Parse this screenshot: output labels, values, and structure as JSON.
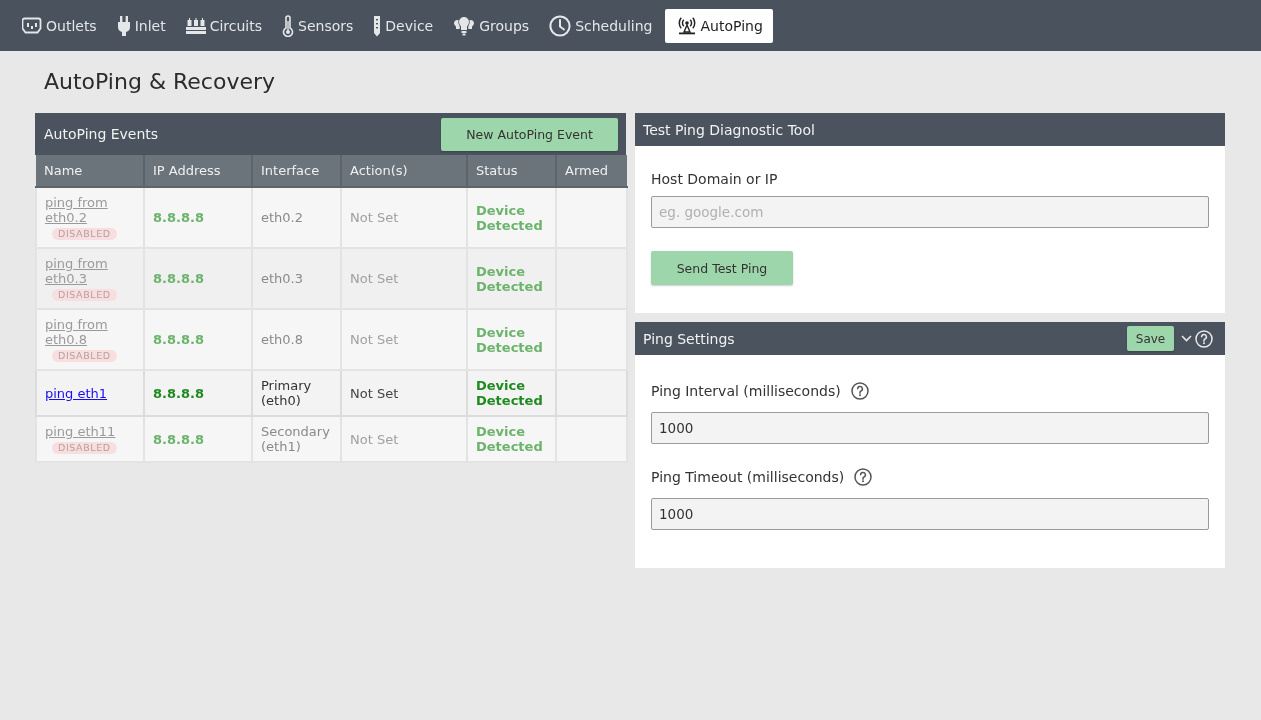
{
  "nav": {
    "tabs": [
      {
        "label": "Outlets",
        "selected": false
      },
      {
        "label": "Inlet",
        "selected": false
      },
      {
        "label": "Circuits",
        "selected": false
      },
      {
        "label": "Sensors",
        "selected": false
      },
      {
        "label": "Device",
        "selected": false
      },
      {
        "label": "Groups",
        "selected": false
      },
      {
        "label": "Scheduling",
        "selected": false
      },
      {
        "label": "AutoPing",
        "selected": true
      }
    ]
  },
  "page": {
    "title": "AutoPing & Recovery"
  },
  "events": {
    "title": "AutoPing Events",
    "new_button": "New AutoPing Event",
    "columns": [
      "Name",
      "IP Address",
      "Interface",
      "Action(s)",
      "Status",
      "Armed"
    ],
    "rows": [
      {
        "name": "ping from eth0.2",
        "disabled": true,
        "badge": "DISABLED",
        "ip": "8.8.8.8",
        "interface": "eth0.2",
        "actions": "Not Set",
        "status": "Device Detected"
      },
      {
        "name": "ping from eth0.3",
        "disabled": true,
        "badge": "DISABLED",
        "ip": "8.8.8.8",
        "interface": "eth0.3",
        "actions": "Not Set",
        "status": "Device Detected"
      },
      {
        "name": "ping from eth0.8",
        "disabled": true,
        "badge": "DISABLED",
        "ip": "8.8.8.8",
        "interface": "eth0.8",
        "actions": "Not Set",
        "status": "Device Detected"
      },
      {
        "name": "ping eth1",
        "disabled": false,
        "ip": "8.8.8.8",
        "interface": "Primary (eth0)",
        "actions": "Not Set",
        "status": "Device Detected"
      },
      {
        "name": "ping eth11",
        "disabled": true,
        "badge": "DISABLED",
        "ip": "8.8.8.8",
        "interface": "Secondary (eth1)",
        "actions": "Not Set",
        "status": "Device Detected"
      }
    ]
  },
  "diagnostic": {
    "title": "Test Ping Diagnostic Tool",
    "field_label": "Host Domain or IP",
    "placeholder": "eg. google.com",
    "button": "Send Test Ping"
  },
  "settings": {
    "title": "Ping Settings",
    "save": "Save",
    "expanded": true,
    "fields": [
      {
        "label": "Ping Interval (milliseconds)",
        "value": "1000"
      },
      {
        "label": "Ping Timeout (milliseconds)",
        "value": "1000"
      }
    ]
  }
}
